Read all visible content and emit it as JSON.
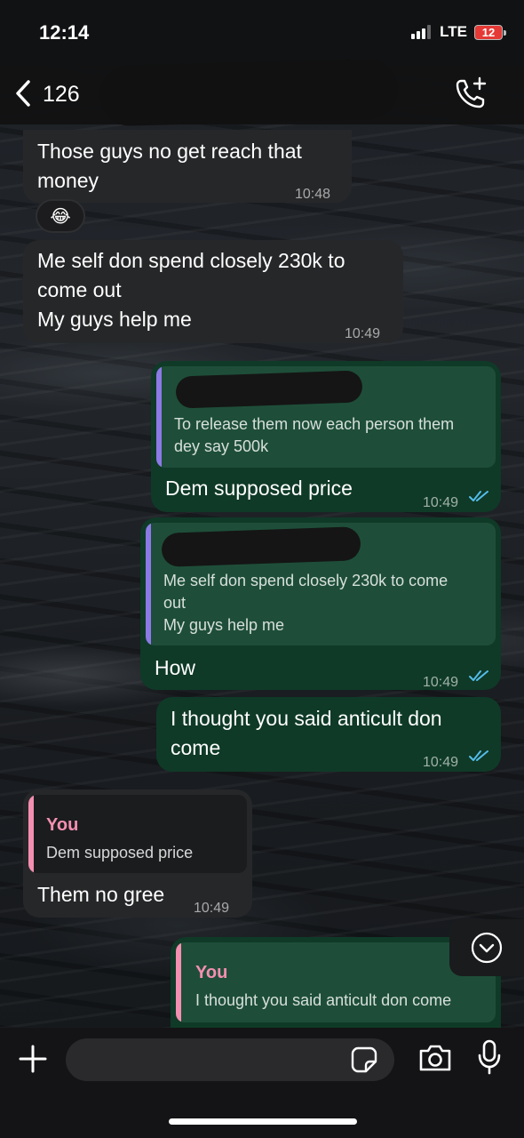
{
  "status_bar": {
    "time": "12:14",
    "network": "LTE",
    "battery": "12",
    "battery_color": "#e53935"
  },
  "header": {
    "unread_count": "126",
    "back_icon": "chevron-left-icon",
    "call_icon": "phone-plus-icon"
  },
  "messages": [
    {
      "direction": "incoming",
      "text": "Those guys no get reach that\nmoney",
      "time": "10:48",
      "reaction": "😂"
    },
    {
      "direction": "incoming",
      "text": "Me self don spend closely 230k to\ncome out\nMy guys help me",
      "time": "10:49"
    },
    {
      "direction": "outgoing",
      "quote": {
        "text": "To release them now each person them\ndey say 500k",
        "bar_color": "#8c7ae6"
      },
      "text": "Dem supposed price",
      "time": "10:49",
      "read": true
    },
    {
      "direction": "outgoing",
      "quote": {
        "text": "Me self don spend closely 230k to come\nout\nMy guys help me",
        "bar_color": "#8c7ae6"
      },
      "text": "How",
      "time": "10:49",
      "read": true
    },
    {
      "direction": "outgoing",
      "text": "I thought you said  anticult don\ncome",
      "time": "10:49",
      "read": true
    },
    {
      "direction": "incoming",
      "quote": {
        "author": "You",
        "text": "Dem supposed price",
        "bar_color": "#f48fb1"
      },
      "text": "Them no gree",
      "time": "10:49"
    },
    {
      "direction": "outgoing",
      "quote": {
        "author": "You",
        "text": "I thought you said  anticult don come",
        "bar_color": "#f48fb1"
      },
      "text": "",
      "time": ""
    }
  ],
  "input_bar": {
    "placeholder": "",
    "icons": [
      "plus-icon",
      "sticker-icon",
      "camera-icon",
      "microphone-icon"
    ]
  },
  "colors": {
    "incoming_bubble": "#262729",
    "outgoing_bubble": "#0f3a27",
    "read_ticks": "#53bdeb"
  }
}
